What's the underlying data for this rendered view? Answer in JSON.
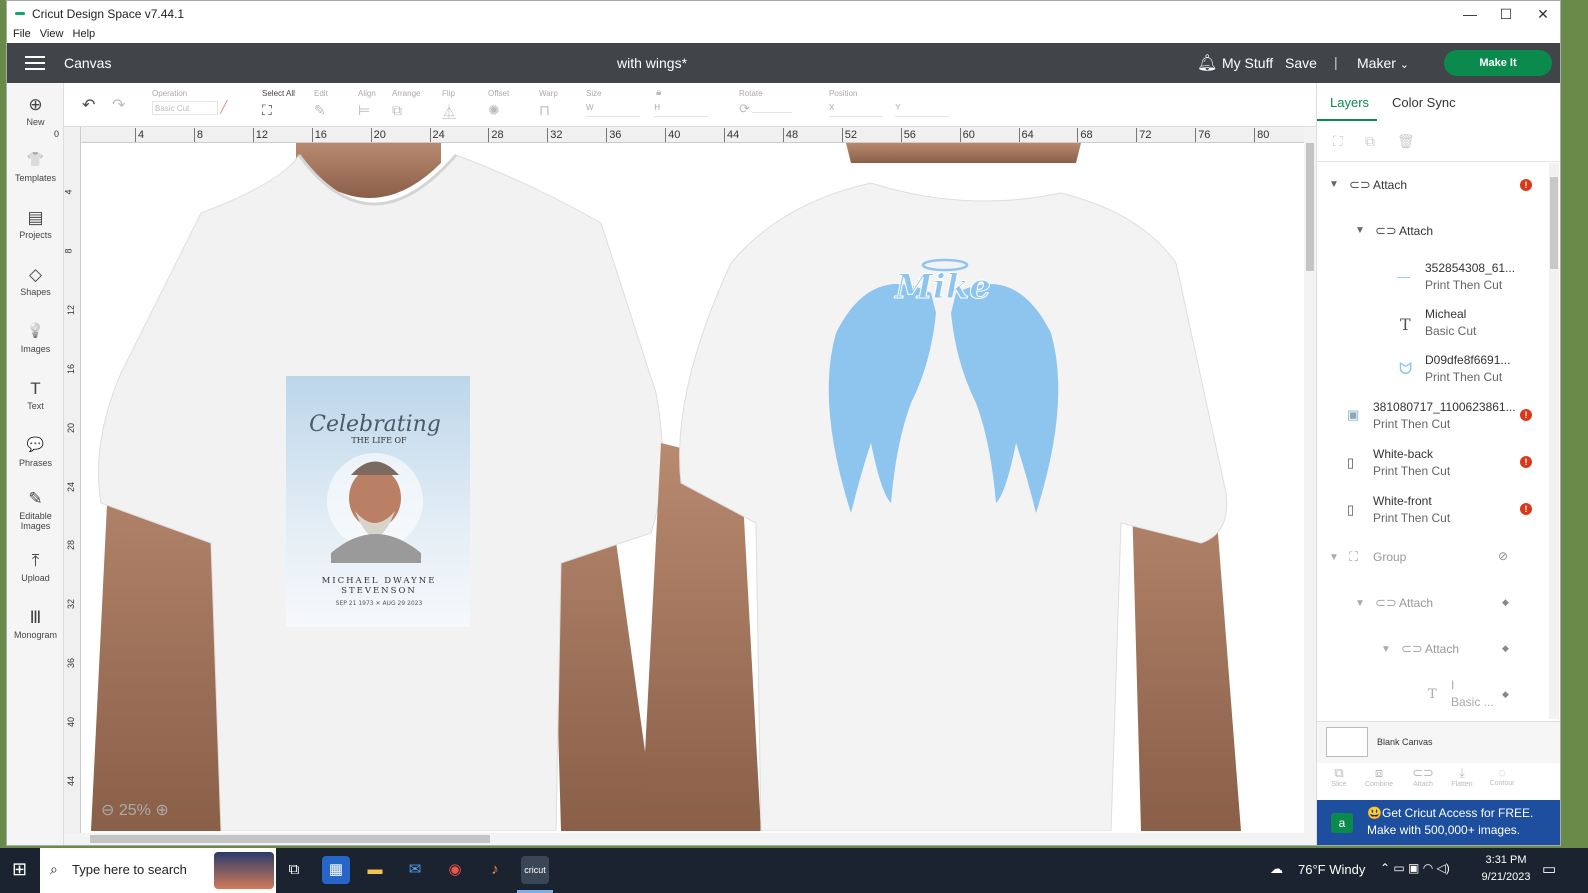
{
  "window": {
    "title": "Cricut Design Space  v7.44.1",
    "controls": {
      "minimize": "—",
      "maximize": "☐",
      "close": "✕"
    }
  },
  "menubar": {
    "items": [
      "File",
      "View",
      "Help"
    ]
  },
  "header": {
    "canvas_label": "Canvas",
    "project_name": "with wings*",
    "my_stuff": "My Stuff",
    "save": "Save",
    "separator": "|",
    "machine": "Maker",
    "make_it": "Make It"
  },
  "leftbar": {
    "tools": [
      {
        "label": "New",
        "icon": "⊕"
      },
      {
        "label": "Templates",
        "icon": "👕"
      },
      {
        "label": "Projects",
        "icon": "▤"
      },
      {
        "label": "Shapes",
        "icon": "◇"
      },
      {
        "label": "Images",
        "icon": "💡"
      },
      {
        "label": "Text",
        "icon": "T"
      },
      {
        "label": "Phrases",
        "icon": "💬"
      },
      {
        "label": "Editable Images",
        "icon": "✎"
      },
      {
        "label": "Upload",
        "icon": "⤒"
      },
      {
        "label": "Monogram",
        "icon": "Ⅲ"
      }
    ]
  },
  "editbar": {
    "operation_label": "Operation",
    "operation_value": "Basic Cut",
    "select_all": "Select All",
    "edit": "Edit",
    "align": "Align",
    "arrange": "Arrange",
    "flip": "Flip",
    "offset": "Offset",
    "warp": "Warp",
    "size": "Size",
    "size_w": "W",
    "size_h": "H",
    "rotate": "Rotate",
    "position": "Position",
    "pos_x": "X",
    "pos_y": "Y"
  },
  "ruler": {
    "top": [
      "4",
      "8",
      "12",
      "16",
      "20",
      "24",
      "28",
      "32",
      "36",
      "40",
      "44",
      "48",
      "52",
      "56",
      "60",
      "64",
      "68",
      "72",
      "76",
      "80"
    ],
    "left": [
      "4",
      "8",
      "12",
      "16",
      "20",
      "24",
      "28",
      "32",
      "36",
      "40",
      "44"
    ],
    "origin": "0"
  },
  "canvas": {
    "zoom": "25%",
    "memorial": {
      "script": "Celebrating",
      "subtitle": "THE LIFE OF",
      "name_line1": "MICHAEL DWAYNE",
      "name_line2": "STEVENSON",
      "dates": "SEP 21 1973 ✕ AUG 29 2023"
    },
    "wings_text": "Mike"
  },
  "rpanel": {
    "tabs": [
      "Layers",
      "Color Sync"
    ],
    "layers": [
      {
        "name": "Attach",
        "sub": ""
      },
      {
        "name": "Attach",
        "sub": ""
      },
      {
        "name": "352854308_61...",
        "sub": "Print Then Cut"
      },
      {
        "name": "Micheal",
        "sub": "Basic Cut"
      },
      {
        "name": "D09dfe8f6691...",
        "sub": "Print Then Cut"
      },
      {
        "name": "381080717_1100623861...",
        "sub": "Print Then Cut"
      },
      {
        "name": "White-back",
        "sub": "Print Then Cut"
      },
      {
        "name": "White-front",
        "sub": "Print Then Cut"
      },
      {
        "name": "Group",
        "sub": ""
      },
      {
        "name": "Attach",
        "sub": ""
      },
      {
        "name": "Attach",
        "sub": ""
      },
      {
        "name": "I",
        "sub": "Basic ..."
      }
    ],
    "blank_canvas": "Blank Canvas",
    "actions": [
      "Slice",
      "Combine",
      "Attach",
      "Flatten",
      "Contour"
    ],
    "promo_line1": "Get Cricut Access for FREE.",
    "promo_line2": "Make with 500,000+ images."
  },
  "taskbar": {
    "search_placeholder": "Type here to search",
    "weather": "76°F  Windy",
    "time": "3:31 PM",
    "date": "9/21/2023"
  },
  "colors": {
    "header": "#414549",
    "make_it": "#0b8a4e",
    "accent": "#0b8a4e",
    "wings": "#8ec5ef",
    "warning": "#d9391b",
    "promo": "#1d4f9e"
  }
}
